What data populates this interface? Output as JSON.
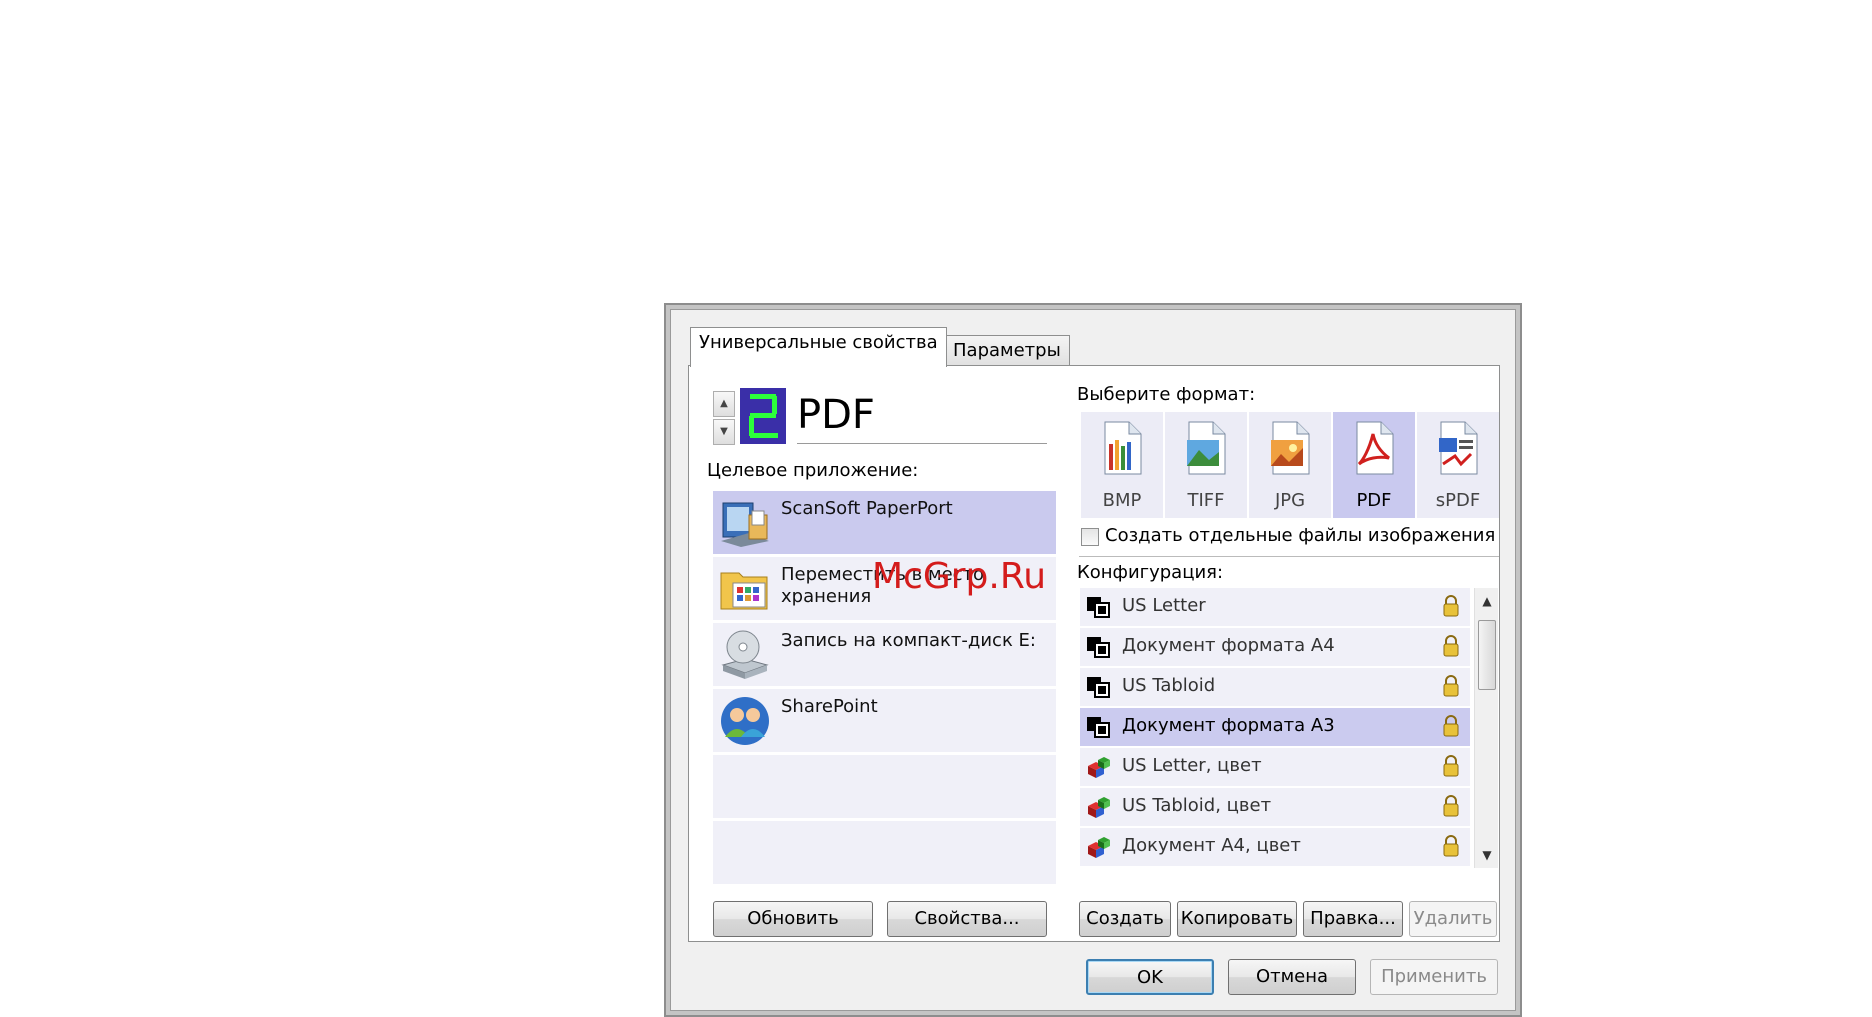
{
  "tabs": [
    {
      "label": "Универсальные свойства"
    },
    {
      "label": "Параметры"
    }
  ],
  "profile": {
    "number": "2",
    "name": "PDF"
  },
  "target_app": {
    "label": "Целевое приложение:",
    "items": [
      {
        "label": "ScanSoft PaperPort",
        "icon": "paperport-icon"
      },
      {
        "label": "Переместить в место хранения",
        "icon": "storage-folder-icon"
      },
      {
        "label": "Запись на компакт-диск  E:",
        "icon": "cd-burn-icon"
      },
      {
        "label": "SharePoint",
        "icon": "sharepoint-icon"
      }
    ]
  },
  "format": {
    "label": "Выберите формат:",
    "items": [
      {
        "label": "BMP"
      },
      {
        "label": "TIFF"
      },
      {
        "label": "JPG"
      },
      {
        "label": "PDF"
      },
      {
        "label": "sPDF"
      }
    ],
    "selected": "PDF"
  },
  "separate_files": {
    "label": "Создать отдельные файлы изображения",
    "checked": false
  },
  "config": {
    "label": "Конфигурация:",
    "items": [
      {
        "label": "US Letter",
        "type": "bw"
      },
      {
        "label": "Документ формата A4",
        "type": "bw"
      },
      {
        "label": "US Tabloid",
        "type": "bw"
      },
      {
        "label": "Документ формата A3",
        "type": "bw"
      },
      {
        "label": "US Letter, цвет",
        "type": "color"
      },
      {
        "label": "US Tabloid, цвет",
        "type": "color"
      },
      {
        "label": "Документ A4, цвет",
        "type": "color"
      }
    ],
    "selected": "Документ формата A3"
  },
  "buttons": {
    "refresh": "Обновить",
    "properties": "Свойства...",
    "create": "Создать",
    "copy": "Копировать",
    "edit": "Правка...",
    "delete": "Удалить",
    "ok": "OK",
    "cancel": "Отмена",
    "apply": "Применить"
  },
  "watermark": "McGrp.Ru",
  "colors": {
    "selection": "#cacaee",
    "list_bg": "#f0f0f8",
    "badge_bg": "#3a2fa8",
    "badge_digit": "#2cff3a",
    "watermark": "#d41c1c"
  }
}
